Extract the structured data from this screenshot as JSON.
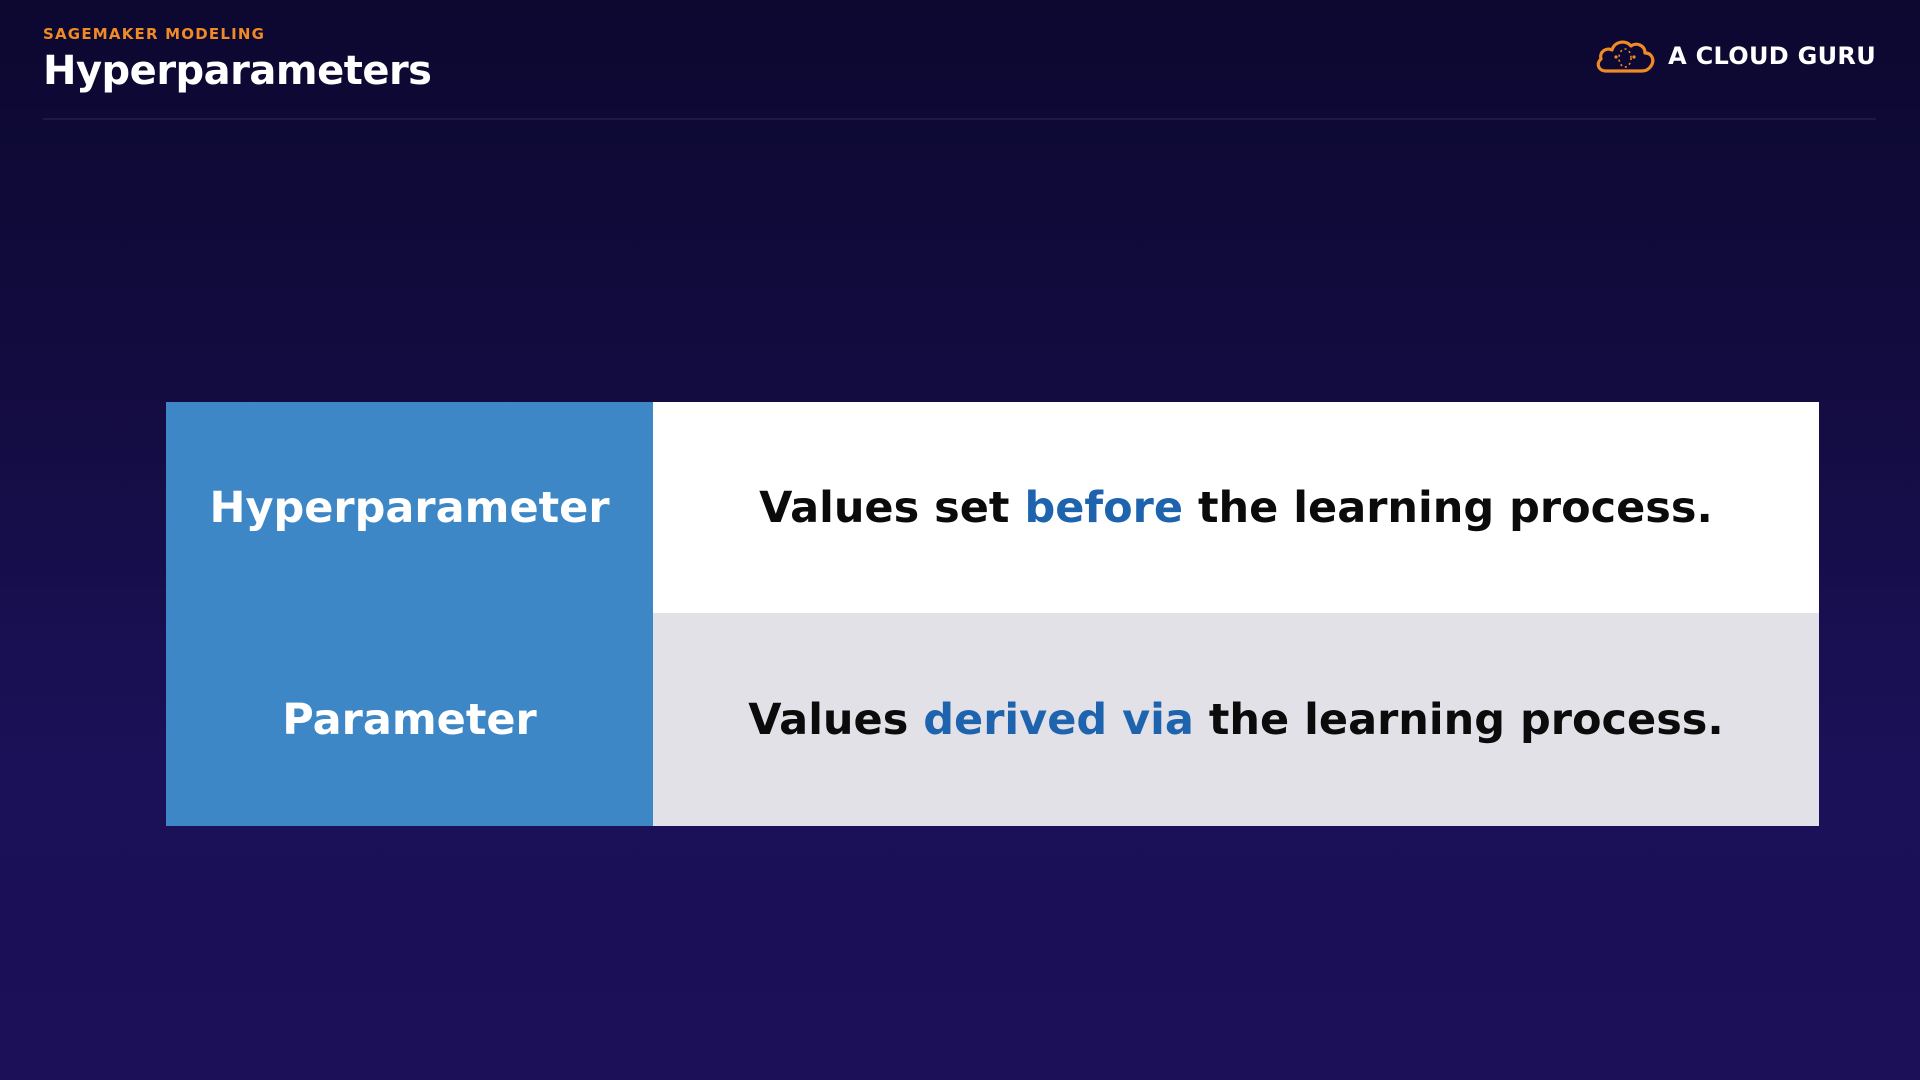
{
  "header": {
    "eyebrow": "SAGEMAKER MODELING",
    "title": "Hyperparameters"
  },
  "brand": {
    "name": "A CLOUD GURU",
    "icon": "cloud-logo-icon",
    "color": "#f08a24"
  },
  "table": {
    "rows": [
      {
        "term": "Hyperparameter",
        "def_pre": "Values set ",
        "def_highlight": "before",
        "def_post": " the learning process."
      },
      {
        "term": "Parameter",
        "def_pre": "Values ",
        "def_highlight": "derived via",
        "def_post": " the learning process."
      }
    ]
  },
  "colors": {
    "term_bg": "#3d87c6",
    "highlight": "#1e63ad",
    "row2_bg": "#e2e1e8"
  }
}
